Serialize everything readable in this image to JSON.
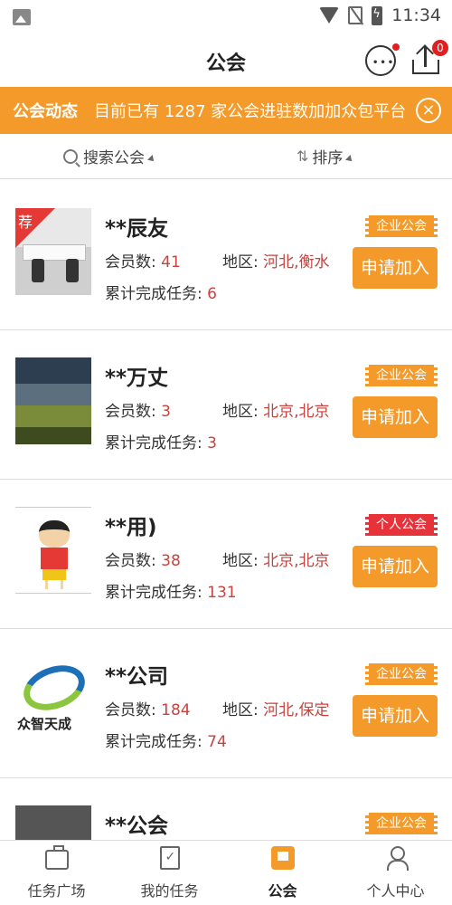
{
  "statusbar": {
    "time": "11:34"
  },
  "header": {
    "title": "公会",
    "upload_badge": "0"
  },
  "banner": {
    "label": "公会动态",
    "text": "目前已有 1287 家公会进驻数加加众包平台",
    "close": "×"
  },
  "filters": {
    "search": "搜索公会",
    "sort": "排序"
  },
  "labels": {
    "members": "会员数: ",
    "region": "地区: ",
    "tasks": "累计完成任务: ",
    "join": "申请加入",
    "recommend": "荐"
  },
  "guilds": [
    {
      "name": "**辰友",
      "members": "41",
      "region": "河北,衡水",
      "tasks": "6",
      "tag": "企业公会"
    },
    {
      "name": "**万丈",
      "members": "3",
      "region": "北京,北京",
      "tasks": "3",
      "tag": "企业公会"
    },
    {
      "name": "**用)",
      "members": "38",
      "region": "北京,北京",
      "tasks": "131",
      "tag": "个人公会"
    },
    {
      "name": "**公司",
      "members": "184",
      "region": "河北,保定",
      "tasks": "74",
      "tag": "企业公会",
      "logo_text": "众智天成"
    },
    {
      "name": "**公会",
      "tag": "企业公会"
    }
  ],
  "tabs": [
    {
      "label": "任务广场",
      "icon": "briefcase-icon"
    },
    {
      "label": "我的任务",
      "icon": "clipboard-icon"
    },
    {
      "label": "公会",
      "icon": "flag-icon"
    },
    {
      "label": "个人中心",
      "icon": "person-icon"
    }
  ],
  "colors": {
    "accent": "#f39a2b",
    "value": "#c8423e",
    "personal_tag": "#e8323a"
  }
}
